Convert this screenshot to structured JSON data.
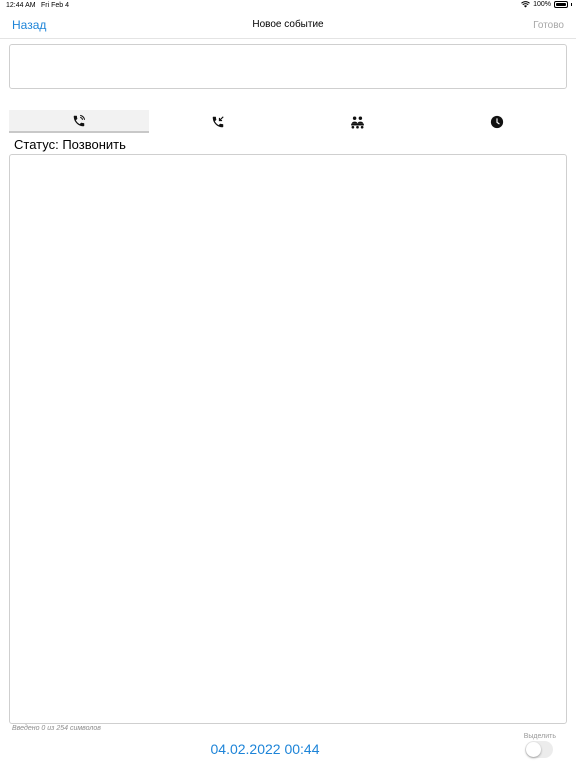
{
  "status_bar": {
    "time": "12:44 AM",
    "date": "Fri Feb 4",
    "battery": "100%",
    "battery_level": 1.0
  },
  "nav": {
    "back_label": "Назад",
    "title": "Новое событие",
    "done_label": "Готово"
  },
  "title_field": {
    "value": ""
  },
  "tabs": [
    {
      "icon": "phone-outgoing-icon",
      "active": true
    },
    {
      "icon": "phone-incoming-icon",
      "active": false
    },
    {
      "icon": "meeting-group-icon",
      "active": false
    },
    {
      "icon": "clock-icon",
      "active": false
    }
  ],
  "status_text": "Статус: Позвонить",
  "note": {
    "value": ""
  },
  "char_counter": "Введено 0 из 254 символов",
  "datetime": "04.02.2022 00:44",
  "highlight": {
    "label": "Выделить",
    "on": false
  },
  "colors": {
    "accent": "#1d84d8",
    "disabled": "#a7a7a7"
  }
}
